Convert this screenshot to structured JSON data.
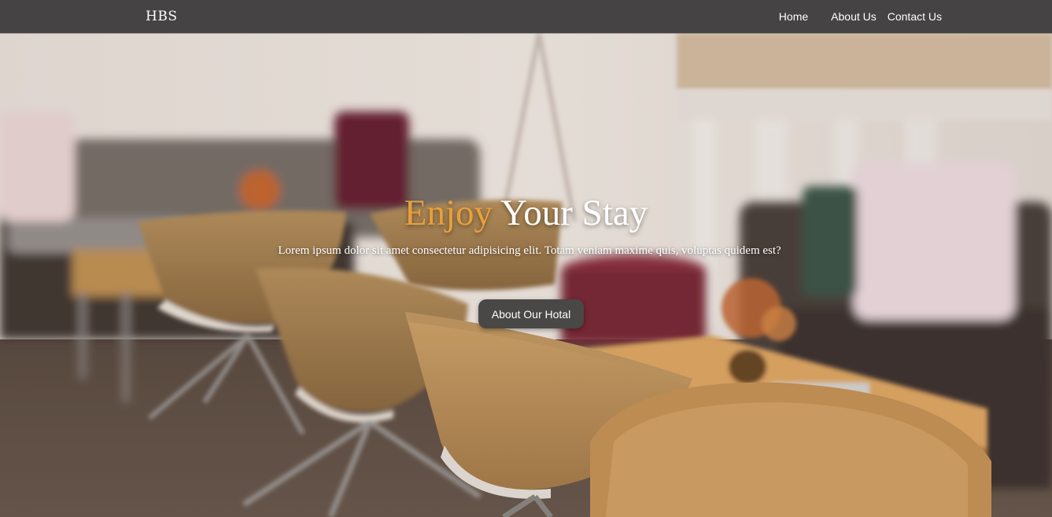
{
  "navbar": {
    "brand": "HBS",
    "links": [
      {
        "label": "Home"
      },
      {
        "label": "About Us"
      },
      {
        "label": "Contact Us"
      }
    ]
  },
  "hero": {
    "title_accent": "Enjoy",
    "title_rest": "Your Stay",
    "text": "Lorem ipsum dolor sit amet consectetur adipisicing elit. Totam veniam maxime quis, voluptas quidem est?",
    "button_label": "About Our Hotal",
    "background": "hotel-lounge-photo"
  },
  "colors": {
    "navbar": "#454343",
    "accent": "#e8a03a",
    "button": "#4a4846"
  }
}
